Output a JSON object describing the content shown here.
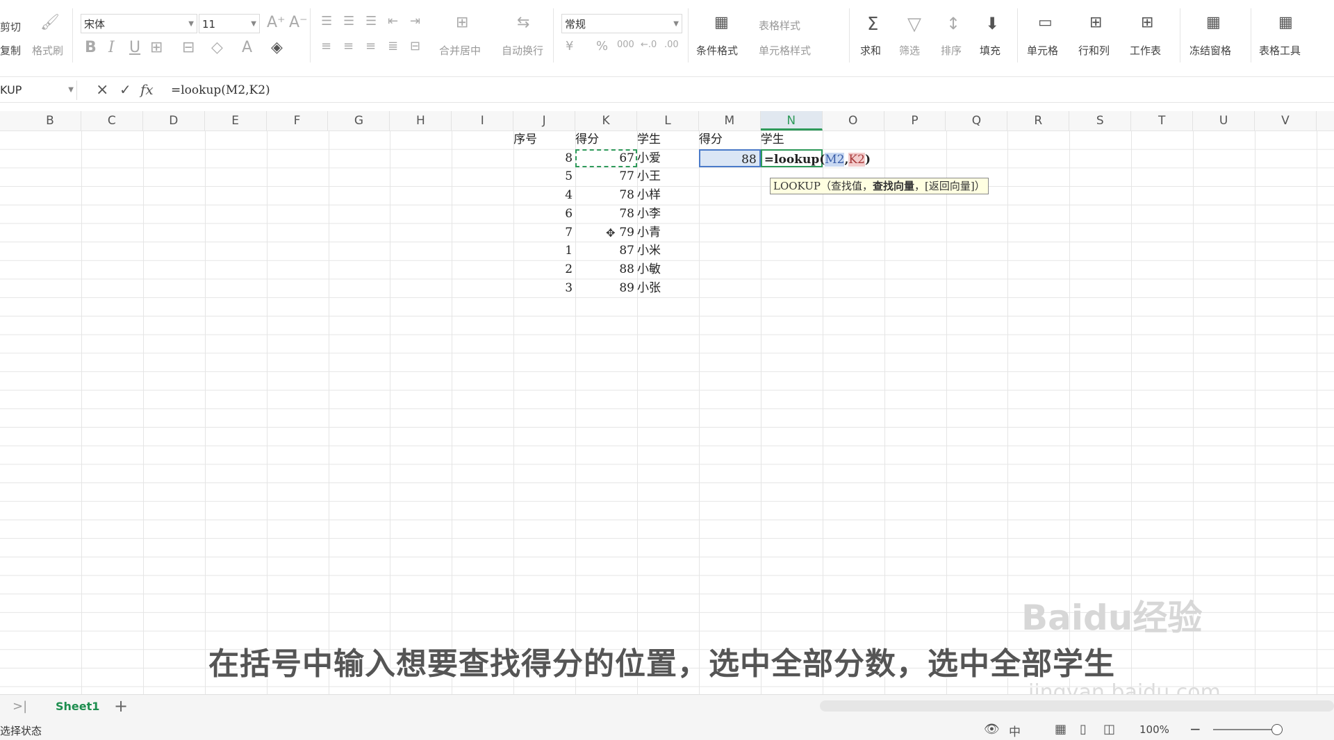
{
  "ribbon": {
    "cut": "剪切",
    "copy": "复制",
    "format_painter": "格式刷",
    "font_name": "宋体",
    "font_size": "11",
    "merge_center": "合并居中",
    "wrap_text": "自动换行",
    "number_format": "常规",
    "currency": "¥",
    "percent": "%",
    "thousands": "000",
    "conditional_format": "条件格式",
    "table_style": "表格样式",
    "cell_style": "单元格样式",
    "sum": "求和",
    "filter": "筛选",
    "sort": "排序",
    "fill": "填充",
    "cells": "单元格",
    "rows_cols": "行和列",
    "worksheet": "工作表",
    "freeze": "冻结窗格",
    "table_tools": "表格工具"
  },
  "formula_bar": {
    "name_box": "KUP",
    "cancel": "×",
    "confirm": "✓",
    "fx": "fx",
    "formula": "=lookup(M2,K2)"
  },
  "columns": [
    "B",
    "C",
    "D",
    "E",
    "F",
    "G",
    "H",
    "I",
    "J",
    "K",
    "L",
    "M",
    "N",
    "O",
    "P",
    "Q",
    "R",
    "S",
    "T",
    "U",
    "V"
  ],
  "selected_column": "N",
  "headers": {
    "J": "序号",
    "K": "得分",
    "L": "学生",
    "M": "得分",
    "N": "学生"
  },
  "rows": [
    {
      "seq": "8",
      "score": "67",
      "name": "小爱"
    },
    {
      "seq": "5",
      "score": "77",
      "name": "小王"
    },
    {
      "seq": "4",
      "score": "78",
      "name": "小样"
    },
    {
      "seq": "6",
      "score": "78",
      "name": "小李"
    },
    {
      "seq": "7",
      "score": "79",
      "name": "小青"
    },
    {
      "seq": "1",
      "score": "87",
      "name": "小米"
    },
    {
      "seq": "2",
      "score": "88",
      "name": "小敏"
    },
    {
      "seq": "3",
      "score": "89",
      "name": "小张"
    }
  ],
  "m2_value": "88",
  "n2_edit": {
    "func": "=lookup(",
    "arg1": "M2",
    "comma": ",",
    "arg2": "K2",
    "close": ")"
  },
  "tooltip": {
    "text": "LOOKUP（查找值，",
    "bold": "查找向量",
    "rest": "，[返回向量]）"
  },
  "subtitle": "在括号中输入想要查找得分的位置，选中全部分数，选中全部学生",
  "watermark": "Baidu经验",
  "watermark_url": "jingyan.baidu.com",
  "sheet_tab": "Sheet1",
  "add_sheet": "+",
  "status_text": "选择状态",
  "zoom": "100%",
  "input_mode": "中"
}
